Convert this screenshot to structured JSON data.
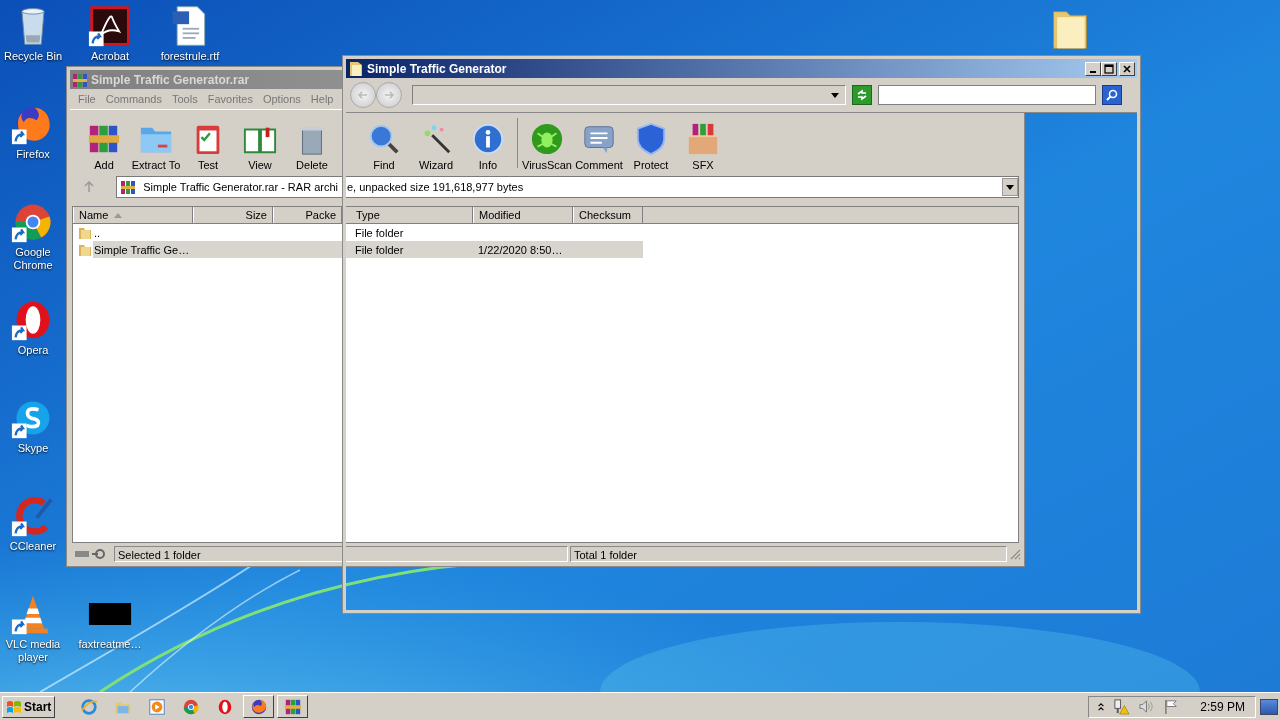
{
  "desktop_icons": [
    {
      "kind": "recycle",
      "label": "Recycle Bin",
      "shortcut": false
    },
    {
      "kind": "pdf",
      "label": "Acrobat",
      "shortcut": true
    },
    {
      "kind": "word",
      "label": "forestrule.rtf",
      "shortcut": false
    },
    {
      "kind": "firefox",
      "label": "Firefox",
      "shortcut": true
    },
    {
      "kind": "chrome",
      "label": "Google Chrome",
      "shortcut": true
    },
    {
      "kind": "opera",
      "label": "Opera",
      "shortcut": true
    },
    {
      "kind": "skype",
      "label": "Skype",
      "shortcut": true
    },
    {
      "kind": "ccleaner",
      "label": "CCleaner",
      "shortcut": true
    },
    {
      "kind": "vlc",
      "label": "VLC media player",
      "shortcut": true
    },
    {
      "kind": "thumb",
      "label": "faxtreatme…",
      "shortcut": false
    },
    {
      "kind": "folder",
      "shortcut": false
    }
  ],
  "winrar": {
    "title": "Simple Traffic Generator.rar",
    "menu": [
      "File",
      "Commands",
      "Tools",
      "Favorites",
      "Options",
      "Help"
    ],
    "toolbar": [
      {
        "kind": "add",
        "label": "Add"
      },
      {
        "kind": "extract",
        "label": "Extract To"
      },
      {
        "kind": "test",
        "label": "Test"
      },
      {
        "kind": "view",
        "label": "View"
      },
      {
        "kind": "delete",
        "label": "Delete"
      },
      {
        "kind": "find",
        "label": "Find"
      },
      {
        "kind": "wizard",
        "label": "Wizard"
      },
      {
        "kind": "info",
        "label": "Info"
      },
      {
        "kind": "virus",
        "label": "VirusScan"
      },
      {
        "kind": "comment",
        "label": "Comment"
      },
      {
        "kind": "protect",
        "label": "Protect"
      },
      {
        "kind": "sfx",
        "label": "SFX"
      }
    ],
    "address": [
      "Simple Traffic Generator.rar - RAR archi",
      "e, unpacked size 191,618,977 bytes"
    ],
    "columns": [
      "Name",
      "Size",
      "Packe",
      "Type",
      "Modified",
      "Checksum"
    ],
    "rows": [
      {
        "name": "..",
        "type": "File folder",
        "modified": "",
        "selected": false
      },
      {
        "name": "Simple Traffic Ge…",
        "type": "File folder",
        "modified": "1/22/2020 8:50…",
        "selected": true
      }
    ],
    "status": [
      "Selected 1 folder",
      "Total 1 folder"
    ]
  },
  "explorer": {
    "title": "Simple Traffic Generator"
  },
  "taskbar": {
    "start": "Start",
    "apps": [
      {
        "kind": "ie",
        "open": false
      },
      {
        "kind": "explorer",
        "open": false
      },
      {
        "kind": "media",
        "open": false
      },
      {
        "kind": "chrome",
        "open": false
      },
      {
        "kind": "opera",
        "open": false
      },
      {
        "kind": "firefox",
        "open": true
      },
      {
        "kind": "winrar",
        "open": true
      }
    ],
    "clock": "2:59 PM"
  }
}
